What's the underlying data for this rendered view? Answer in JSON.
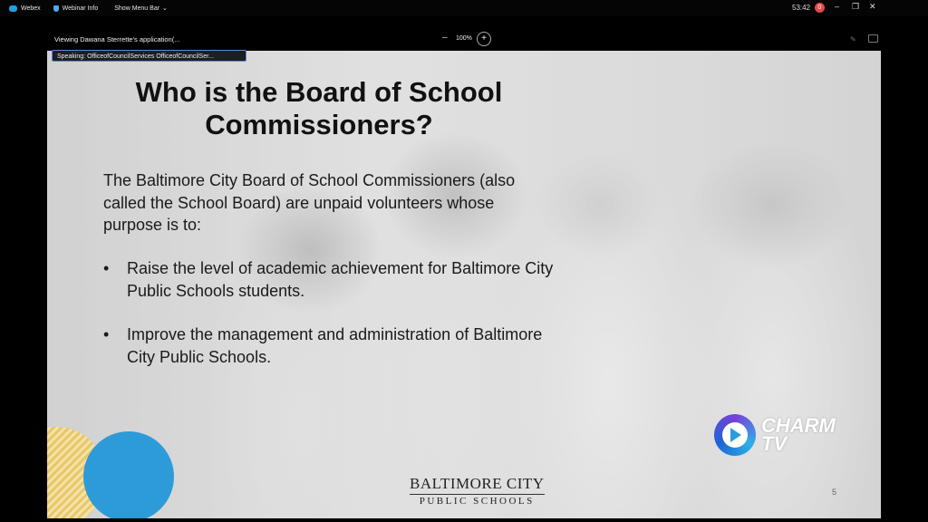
{
  "menubar": {
    "app_name": "Webex",
    "webinar_info": "Webinar Info",
    "show_menu_bar": "Show Menu Bar",
    "timer": "53:42",
    "rec_badge": "0"
  },
  "window_controls": {
    "minimize": "–",
    "restore": "❐",
    "close": "✕"
  },
  "share_bar": {
    "viewing_text": "Viewing Dawana Sterrette's application(...",
    "zoom_minus": "–",
    "zoom_level": "100%",
    "zoom_plus": "+"
  },
  "speaking": {
    "text": "Speaking: OfficeofCouncilServices OfficeofCouncilSer..."
  },
  "slide": {
    "title": "Who is the Board of School Commissioners?",
    "intro": "The Baltimore City Board of School Commissioners (also called the School Board) are unpaid volunteers whose purpose is to:",
    "bullets": [
      {
        "marker": "•",
        "text": "Raise the level of academic achievement for Baltimore City Public Schools students."
      },
      {
        "marker": "•",
        "text": "Improve the management and administration of Baltimore City Public Schools."
      }
    ],
    "logo_line1": "BALTIMORE CITY",
    "logo_line2": "PUBLIC SCHOOLS",
    "page_number": "5"
  },
  "watermark": {
    "line1": "CHARM",
    "line2": "TV"
  },
  "colors": {
    "accent_blue": "#2d9bd8",
    "speaking_border": "#5c8ad8",
    "record": "#e24a4a"
  }
}
